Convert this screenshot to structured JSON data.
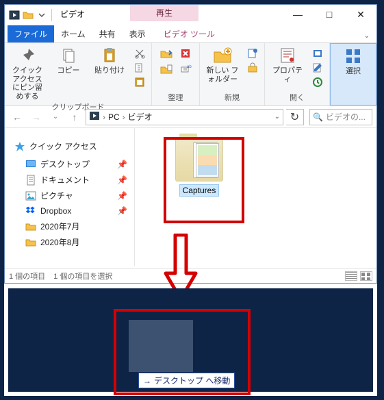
{
  "titlebar": {
    "app_icon": "video-library-icon",
    "title": "ビデオ",
    "context_tab": "再生",
    "min": "—",
    "max": "□",
    "close": "✕"
  },
  "tabs": {
    "file": "ファイル",
    "home": "ホーム",
    "share": "共有",
    "view": "表示",
    "video_tools": "ビデオ ツール"
  },
  "ribbon": {
    "clipboard": {
      "pin": "クイック アクセス\nにピン留めする",
      "copy": "コピー",
      "paste": "貼り付け",
      "label": "クリップボード"
    },
    "organize": {
      "label": "整理"
    },
    "new": {
      "newfolder": "新しい\nフォルダー",
      "label": "新規"
    },
    "open": {
      "properties": "プロパティ",
      "label": "開く"
    },
    "select": {
      "select": "選択",
      "label": ""
    }
  },
  "address": {
    "crumb1": "PC",
    "crumb2": "ビデオ",
    "search_placeholder": "ビデオの..."
  },
  "nav": {
    "quick_access": "クイック アクセス",
    "items": [
      {
        "label": "デスクトップ",
        "icon": "desktop"
      },
      {
        "label": "ドキュメント",
        "icon": "document"
      },
      {
        "label": "ピクチャ",
        "icon": "pictures"
      },
      {
        "label": "Dropbox",
        "icon": "dropbox"
      },
      {
        "label": "2020年7月",
        "icon": "folder"
      },
      {
        "label": "2020年8月",
        "icon": "folder"
      }
    ]
  },
  "filepane": {
    "item_name": "Captures"
  },
  "status": {
    "count": "1 個の項目",
    "selected": "1 個の項目を選択"
  },
  "drag_tooltip": "デスクトップ へ移動"
}
